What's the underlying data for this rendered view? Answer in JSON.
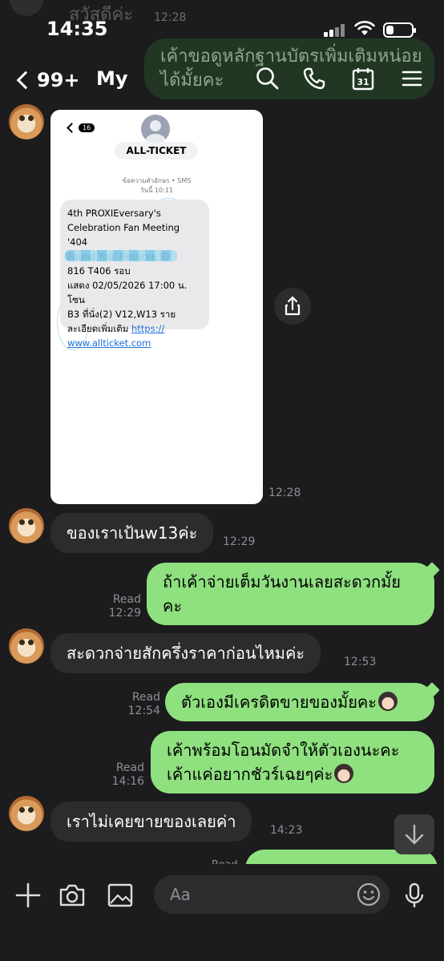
{
  "ghost": {
    "text_top": "สวัสดีค่ะ",
    "time_top": "12:28",
    "bubble_text": "เค้าขอดูหลักฐานบัตรเพิ่มเติมหน่อยได้มั้ยคะ",
    "time_2": "12:28"
  },
  "status_bar": {
    "time": "14:35",
    "battery_level": 0.3
  },
  "header": {
    "back_count": "99+",
    "title": "My",
    "icons": [
      "search-icon",
      "phone-icon",
      "calendar-icon",
      "menu-icon"
    ],
    "calendar_day": "31"
  },
  "card": {
    "back_badge": "16",
    "contact": "ALL-TICKET",
    "meta_line1": "ข้อความตัวอักษร • SMS",
    "meta_line2": "วันนี้ 10:11",
    "sms_line1": "4th PROXIEversary's",
    "sms_line2": "Celebration Fan Meeting '404",
    "sms_line3": "Found You' Reserve ID",
    "sms_line4": "816          T406 รอบ",
    "sms_line5": "แสดง 02/05/2026 17:00 น. โซน",
    "sms_line6": "B3 ที่นั่ง(2) V12,W13  ราย",
    "sms_line7": "ละเอียดเพิ่มเติม",
    "sms_link1": "https://",
    "sms_link2": "www.allticket.com",
    "time": "12:28"
  },
  "messages": [
    {
      "side": "in",
      "text": "ของเราเป้นw13ค่ะ",
      "time": "12:29"
    },
    {
      "side": "out",
      "text_line1": "ถ้าเค้าจ่ายเต็มวันงานเลยสะดวกมั้ย",
      "text_line2": "คะ",
      "read": "Read",
      "time": "12:29"
    },
    {
      "side": "in",
      "text": "สะดวกจ่ายสักครึ่งราคาก่อนไหมค่ะ",
      "time": "12:53"
    },
    {
      "side": "out",
      "text_line1": "ตัวเองมีเครดิตขายของมั้ยคะ",
      "read": "Read",
      "time": "12:54"
    },
    {
      "side": "out",
      "text_line1": "เค้าพร้อมโอนมัดจำให้ตัวเองนะคะ",
      "text_line2": "เค้าแค่อยากชัวร์เฉยๆค่ะ",
      "read": "Read",
      "time": "14:16"
    },
    {
      "side": "in",
      "text": "เราไม่เคยขายของเลยค่า",
      "time": "14:23"
    }
  ],
  "partial": {
    "read": "Read"
  },
  "input_bar": {
    "placeholder": "Aa",
    "icons": [
      "plus-icon",
      "camera-icon",
      "image-icon",
      "emoji-icon",
      "microphone-icon"
    ]
  },
  "colors": {
    "background": "#1c1c1e",
    "incoming": "#2c2c2e",
    "outgoing": "#8fe07f",
    "muted": "#8e8e93"
  }
}
